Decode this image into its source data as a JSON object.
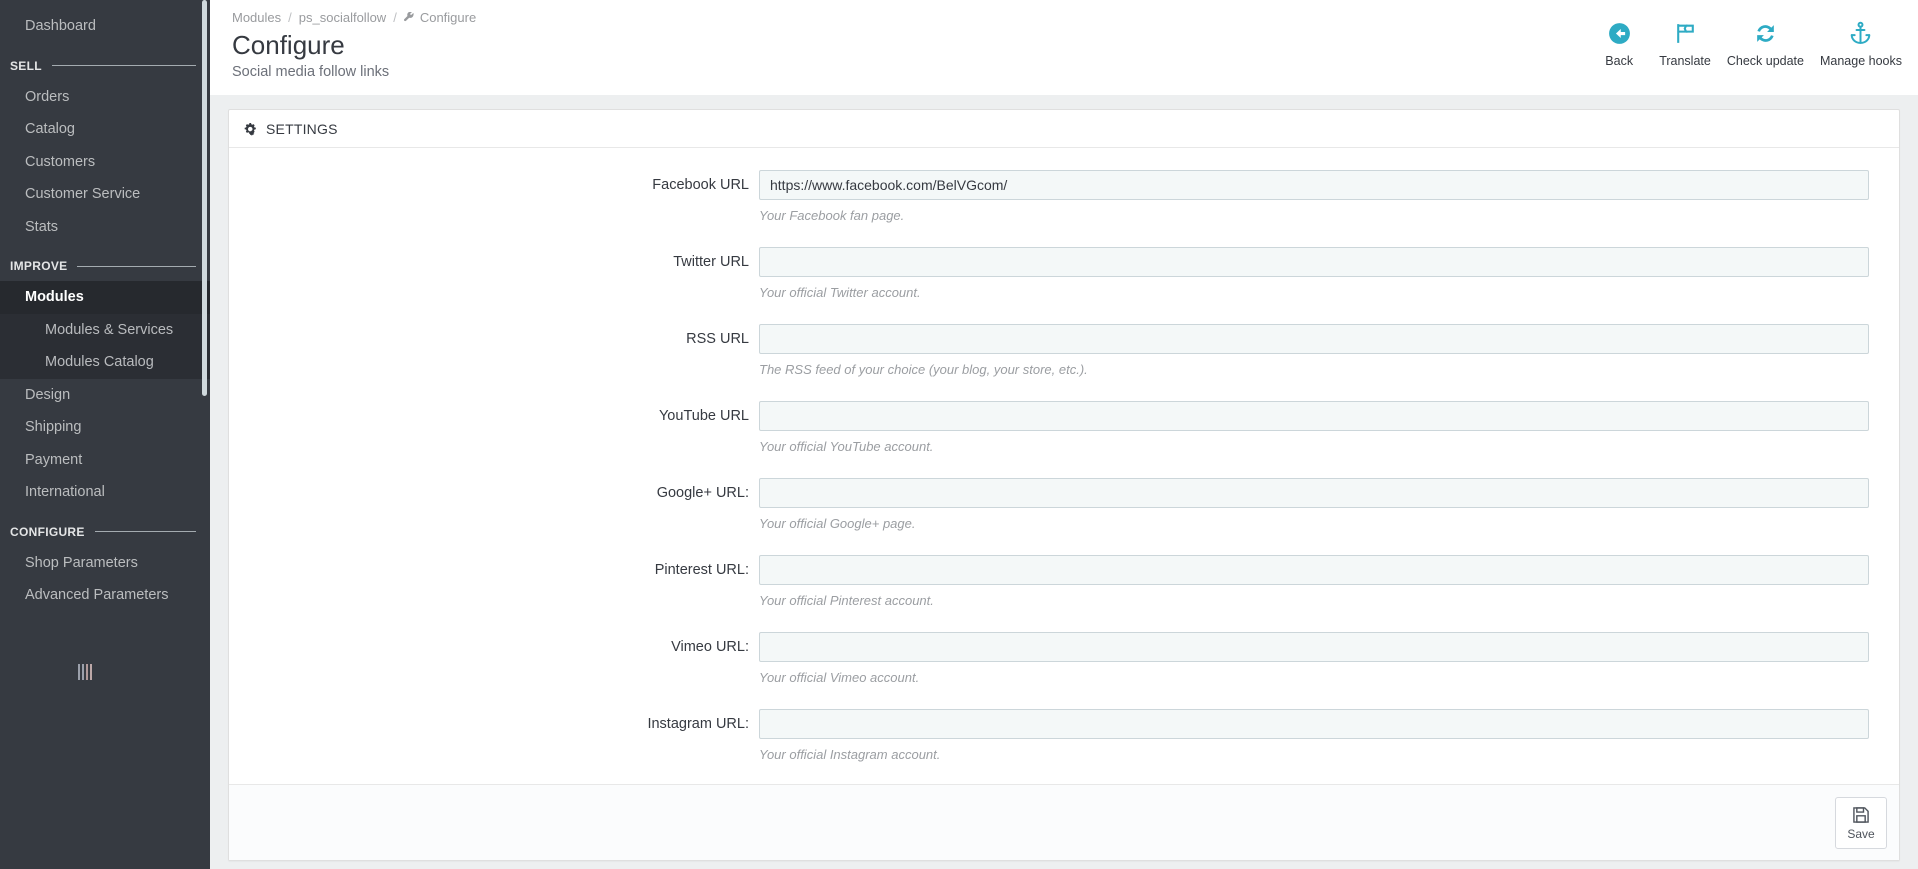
{
  "accent_color": "#2eabc4",
  "sidebar": {
    "top_items": [
      {
        "label": "Dashboard",
        "name": "dashboard"
      }
    ],
    "sections": [
      {
        "title": "SELL",
        "name": "sell",
        "items": [
          {
            "label": "Orders",
            "name": "orders"
          },
          {
            "label": "Catalog",
            "name": "catalog"
          },
          {
            "label": "Customers",
            "name": "customers"
          },
          {
            "label": "Customer Service",
            "name": "customer-service"
          },
          {
            "label": "Stats",
            "name": "stats"
          }
        ]
      },
      {
        "title": "IMPROVE",
        "name": "improve",
        "items": [
          {
            "label": "Modules",
            "name": "modules",
            "active": true,
            "submenu": [
              {
                "label": "Modules & Services",
                "name": "modules-services"
              },
              {
                "label": "Modules Catalog",
                "name": "modules-catalog"
              }
            ]
          },
          {
            "label": "Design",
            "name": "design"
          },
          {
            "label": "Shipping",
            "name": "shipping"
          },
          {
            "label": "Payment",
            "name": "payment"
          },
          {
            "label": "International",
            "name": "international"
          }
        ]
      },
      {
        "title": "CONFIGURE",
        "name": "configure",
        "items": [
          {
            "label": "Shop Parameters",
            "name": "shop-parameters"
          },
          {
            "label": "Advanced Parameters",
            "name": "advanced-parameters"
          }
        ]
      }
    ],
    "collapse_icon": "collapse-menu-icon"
  },
  "header": {
    "breadcrumb": [
      {
        "label": "Modules",
        "name": "modules"
      },
      {
        "label": "ps_socialfollow",
        "name": "ps-socialfollow"
      },
      {
        "label": "Configure",
        "name": "configure",
        "icon": "wrench-icon"
      }
    ],
    "separator": "/",
    "title": "Configure",
    "subtitle": "Social media follow links",
    "toolbar": [
      {
        "label": "Back",
        "name": "back",
        "icon": "arrow-circle-left-icon"
      },
      {
        "label": "Translate",
        "name": "translate",
        "icon": "flag-icon"
      },
      {
        "label": "Check update",
        "name": "check-update",
        "icon": "refresh-icon"
      },
      {
        "label": "Manage hooks",
        "name": "manage-hooks",
        "icon": "anchor-icon"
      }
    ]
  },
  "panel": {
    "header_icon": "cogs-icon",
    "header_title": "SETTINGS",
    "fields": [
      {
        "name": "facebook-url",
        "label": "Facebook URL",
        "value": "https://www.facebook.com/BelVGcom/",
        "placeholder": "",
        "hint": "Your Facebook fan page."
      },
      {
        "name": "twitter-url",
        "label": "Twitter URL",
        "value": "",
        "placeholder": "",
        "hint": "Your official Twitter account."
      },
      {
        "name": "rss-url",
        "label": "RSS URL",
        "value": "",
        "placeholder": "",
        "hint": "The RSS feed of your choice (your blog, your store, etc.)."
      },
      {
        "name": "youtube-url",
        "label": "YouTube URL",
        "value": "",
        "placeholder": "",
        "hint": "Your official YouTube account."
      },
      {
        "name": "googleplus-url",
        "label": "Google+ URL:",
        "value": "",
        "placeholder": "",
        "hint": "Your official Google+ page."
      },
      {
        "name": "pinterest-url",
        "label": "Pinterest URL:",
        "value": "",
        "placeholder": "",
        "hint": "Your official Pinterest account."
      },
      {
        "name": "vimeo-url",
        "label": "Vimeo URL:",
        "value": "",
        "placeholder": "",
        "hint": "Your official Vimeo account."
      },
      {
        "name": "instagram-url",
        "label": "Instagram URL:",
        "value": "",
        "placeholder": "",
        "hint": "Your official Instagram account."
      }
    ],
    "save": {
      "label": "Save",
      "icon": "floppy-disk-icon"
    }
  }
}
